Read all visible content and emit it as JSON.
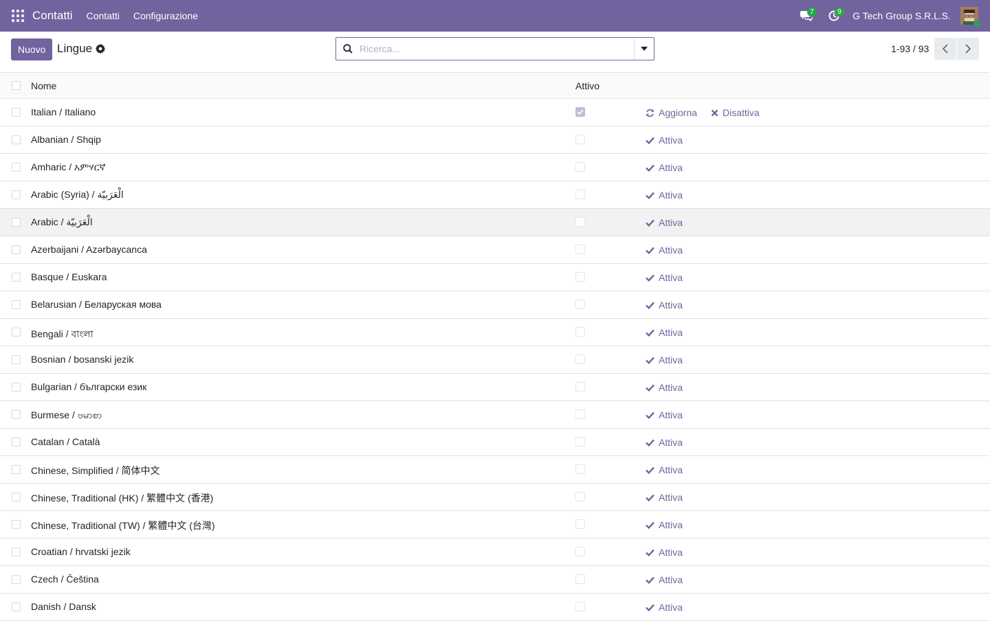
{
  "navbar": {
    "app_name": "Contatti",
    "menu": [
      "Contatti",
      "Configurazione"
    ],
    "messages_count": "7",
    "activities_count": "9",
    "company": "G Tech Group S.R.L.S.",
    "accent": "#71639e"
  },
  "control": {
    "new_label": "Nuovo",
    "breadcrumb": "Lingue",
    "search_placeholder": "Ricerca...",
    "pager": "1-93 / 93"
  },
  "table": {
    "headers": {
      "name": "Nome",
      "active": "Attivo"
    },
    "rows": [
      {
        "name": "Italian / Italiano",
        "active": true,
        "actions": [
          "Aggiorna",
          "Disattiva"
        ]
      },
      {
        "name": "Albanian / Shqip",
        "active": false,
        "actions": [
          "Attiva"
        ]
      },
      {
        "name": "Amharic / አምሃርኛ",
        "active": false,
        "actions": [
          "Attiva"
        ]
      },
      {
        "name": "Arabic (Syria) / الْعَرَبيّة",
        "active": false,
        "actions": [
          "Attiva"
        ]
      },
      {
        "name": "Arabic / الْعَرَبيّة",
        "active": false,
        "actions": [
          "Attiva"
        ]
      },
      {
        "name": "Azerbaijani / Azərbaycanca",
        "active": false,
        "actions": [
          "Attiva"
        ]
      },
      {
        "name": "Basque / Euskara",
        "active": false,
        "actions": [
          "Attiva"
        ]
      },
      {
        "name": "Belarusian / Беларуская мова",
        "active": false,
        "actions": [
          "Attiva"
        ]
      },
      {
        "name": "Bengali / বাংলা",
        "active": false,
        "actions": [
          "Attiva"
        ]
      },
      {
        "name": "Bosnian / bosanski jezik",
        "active": false,
        "actions": [
          "Attiva"
        ]
      },
      {
        "name": "Bulgarian / български език",
        "active": false,
        "actions": [
          "Attiva"
        ]
      },
      {
        "name": "Burmese / ဗမာစာ",
        "active": false,
        "actions": [
          "Attiva"
        ]
      },
      {
        "name": "Catalan / Català",
        "active": false,
        "actions": [
          "Attiva"
        ]
      },
      {
        "name": "Chinese, Simplified / 简体中文",
        "active": false,
        "actions": [
          "Attiva"
        ]
      },
      {
        "name": "Chinese, Traditional (HK) / 繁體中文 (香港)",
        "active": false,
        "actions": [
          "Attiva"
        ]
      },
      {
        "name": "Chinese, Traditional (TW) / 繁體中文 (台灣)",
        "active": false,
        "actions": [
          "Attiva"
        ]
      },
      {
        "name": "Croatian / hrvatski jezik",
        "active": false,
        "actions": [
          "Attiva"
        ]
      },
      {
        "name": "Czech / Čeština",
        "active": false,
        "actions": [
          "Attiva"
        ]
      },
      {
        "name": "Danish / Dansk",
        "active": false,
        "actions": [
          "Attiva"
        ]
      }
    ]
  }
}
